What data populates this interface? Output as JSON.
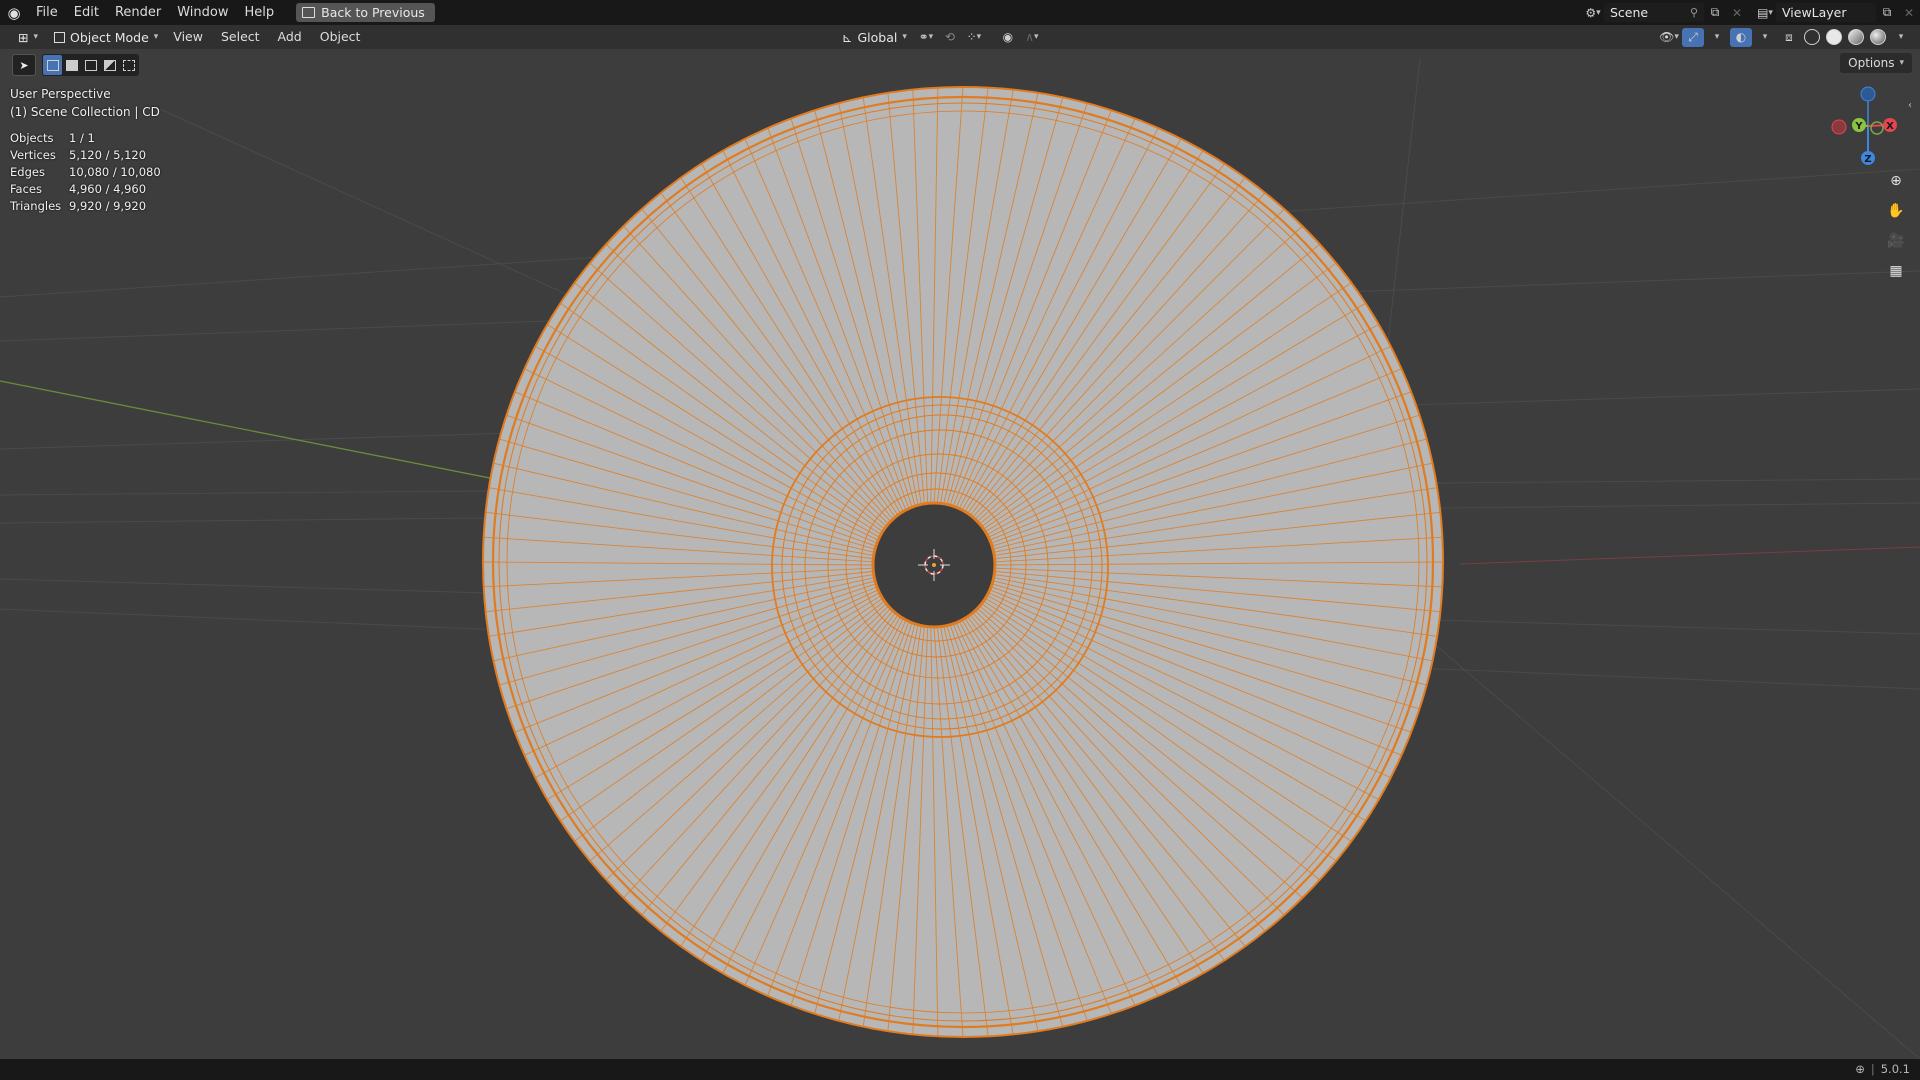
{
  "topbar": {
    "menus": [
      "File",
      "Edit",
      "Render",
      "Window",
      "Help"
    ],
    "back_label": "Back to Previous",
    "scene_name": "Scene",
    "view_layer": "ViewLayer"
  },
  "header": {
    "mode": "Object Mode",
    "menus": [
      "View",
      "Select",
      "Add",
      "Object"
    ],
    "transform_orientation": "Global",
    "options_label": "Options"
  },
  "viewport": {
    "perspective_label": "User Perspective",
    "collection_label": "(1) Scene Collection | CD",
    "stats": [
      {
        "label": "Objects",
        "value": "1 / 1"
      },
      {
        "label": "Vertices",
        "value": "5,120 / 5,120"
      },
      {
        "label": "Edges",
        "value": "10,080 / 10,080"
      },
      {
        "label": "Faces",
        "value": "4,960 / 4,960"
      },
      {
        "label": "Triangles",
        "value": "9,920 / 9,920"
      }
    ],
    "gizmo": {
      "x_label": "X",
      "y_label": "Y",
      "z_label": "Z",
      "x_color": "#e5454f",
      "y_color": "#8bc53f",
      "z_color": "#3d87e0"
    },
    "selection_color": "#e07b1f",
    "mesh_color": "#b7b7b7"
  },
  "statusbar": {
    "version": "5.0.1"
  }
}
